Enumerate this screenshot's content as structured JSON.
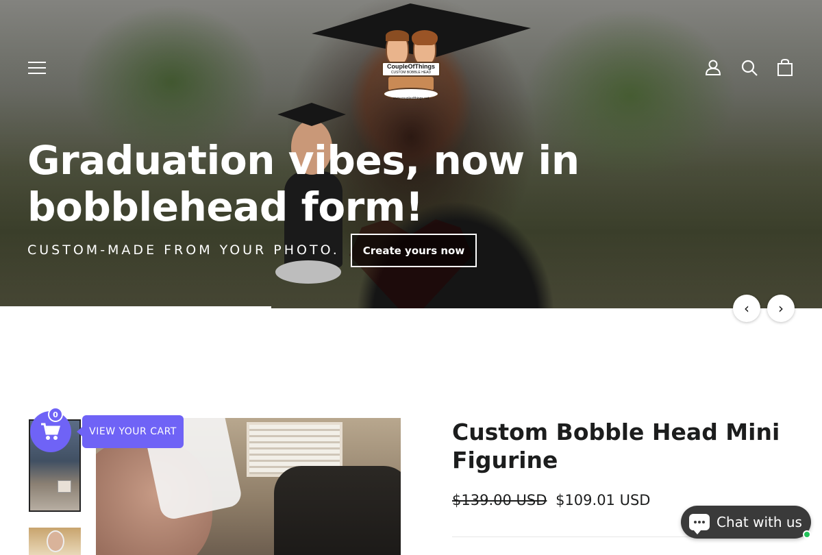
{
  "header": {
    "logo": {
      "brand": "CoupleOfThings",
      "tagline": "CUSTOM BOBBLE HEAD",
      "url": "www.coupleofthings.net"
    },
    "icons": [
      "menu-icon",
      "account-icon",
      "search-icon",
      "cart-icon"
    ]
  },
  "hero": {
    "title": "Graduation vibes, now in bobblehead form!",
    "subtitle": "CUSTOM-MADE FROM YOUR PHOTO.",
    "cta_label": "Create yours now",
    "prev_label": "‹",
    "next_label": "›",
    "slide_progress": 0.33
  },
  "cart_widget": {
    "count": "0",
    "label": "VIEW YOUR CART",
    "color": "#6f63f6"
  },
  "product": {
    "title": "Custom Bobble Head Mini Figurine",
    "compare_price": "$139.00 USD",
    "price": "$109.01 USD"
  },
  "chat": {
    "label": "Chat with us",
    "status_color": "#22c25a"
  }
}
